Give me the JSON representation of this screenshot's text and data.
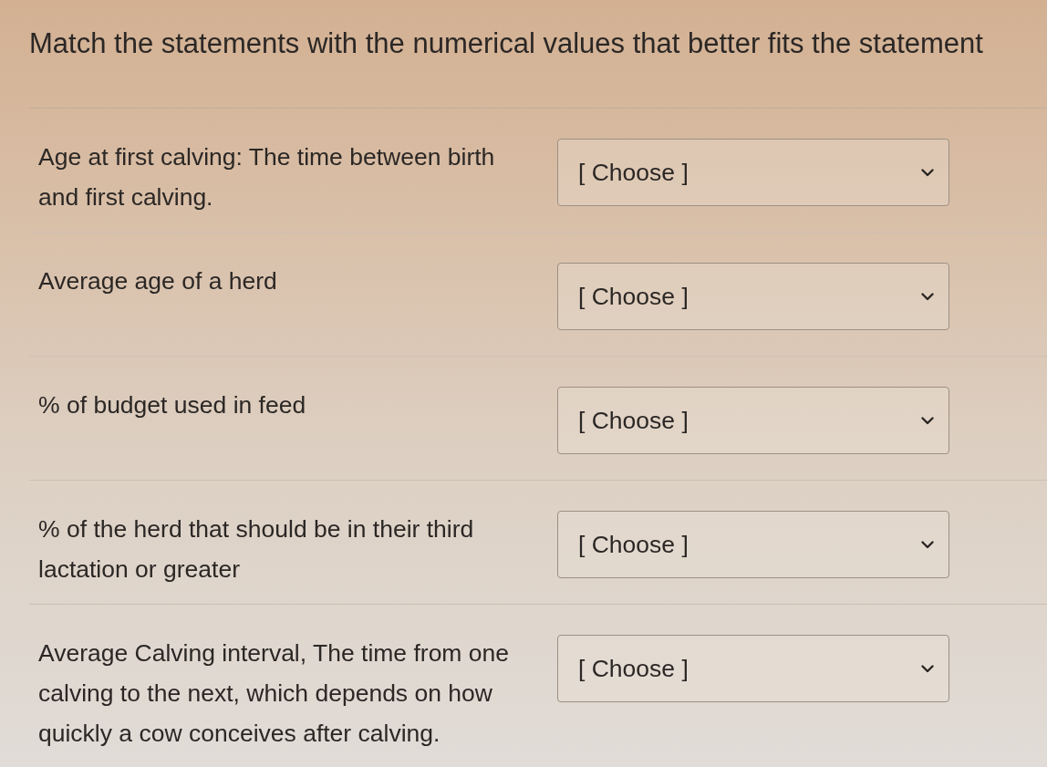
{
  "title": "Match the statements with the numerical values that better fits the statement",
  "questions": [
    {
      "statement": "Age at first calving: The time between birth and first calving.",
      "dropdown": {
        "value": "[ Choose ]"
      }
    },
    {
      "statement": "Average age of a herd",
      "dropdown": {
        "value": "[ Choose ]"
      }
    },
    {
      "statement": "% of budget used in feed",
      "dropdown": {
        "value": "[ Choose ]"
      }
    },
    {
      "statement": "% of the herd that should be in their third lactation or greater",
      "dropdown": {
        "value": "[ Choose ]"
      }
    },
    {
      "statement": "Average Calving interval, The time from one calving to the next, which depends on how quickly a cow conceives after calving.",
      "dropdown": {
        "value": "[ Choose ]"
      }
    }
  ]
}
